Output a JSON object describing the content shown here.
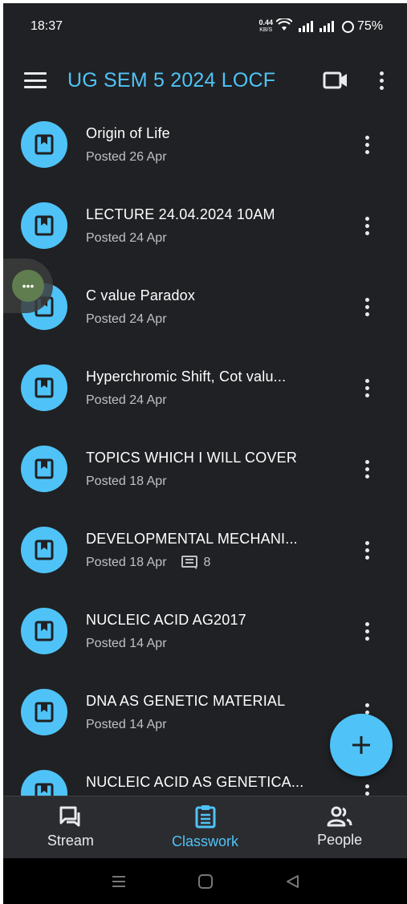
{
  "status_bar": {
    "time": "18:37",
    "net_speed_value": "0.44",
    "net_speed_unit": "KB/S",
    "battery": "75%"
  },
  "app_bar": {
    "title": "UG SEM 5 2024 LOCF",
    "icons": [
      "menu-icon",
      "video-camera-icon",
      "more-vert-icon"
    ]
  },
  "classwork": {
    "items": [
      {
        "title": "Origin of Life",
        "meta": "Posted 26 Apr"
      },
      {
        "title": "LECTURE 24.04.2024 10AM",
        "meta": "Posted 24 Apr"
      },
      {
        "title": "C value Paradox",
        "meta": "Posted 24 Apr"
      },
      {
        "title": "Hyperchromic Shift, Cot valu...",
        "meta": "Posted 24 Apr"
      },
      {
        "title": "TOPICS WHICH I WILL COVER",
        "meta": "Posted 18 Apr"
      },
      {
        "title": "DEVELOPMENTAL MECHANI...",
        "meta": "Posted 18 Apr",
        "comment_count": "8"
      },
      {
        "title": "NUCLEIC ACID AG2017",
        "meta": "Posted 14 Apr"
      },
      {
        "title": "DNA AS GENETIC MATERIAL",
        "meta": "Posted 14 Apr"
      },
      {
        "title": "NUCLEIC ACID AS GENETICA...",
        "meta": ""
      }
    ]
  },
  "fab": {
    "icon": "plus-icon"
  },
  "bottom_nav": {
    "tabs": [
      {
        "label": "Stream",
        "icon": "stream-icon"
      },
      {
        "label": "Classwork",
        "icon": "clipboard-icon",
        "active": true
      },
      {
        "label": "People",
        "icon": "people-icon"
      }
    ]
  },
  "colors": {
    "accent": "#4fc3f7",
    "background": "#202124",
    "text_primary": "#ffffff",
    "text_secondary": "#bdc1c6"
  }
}
